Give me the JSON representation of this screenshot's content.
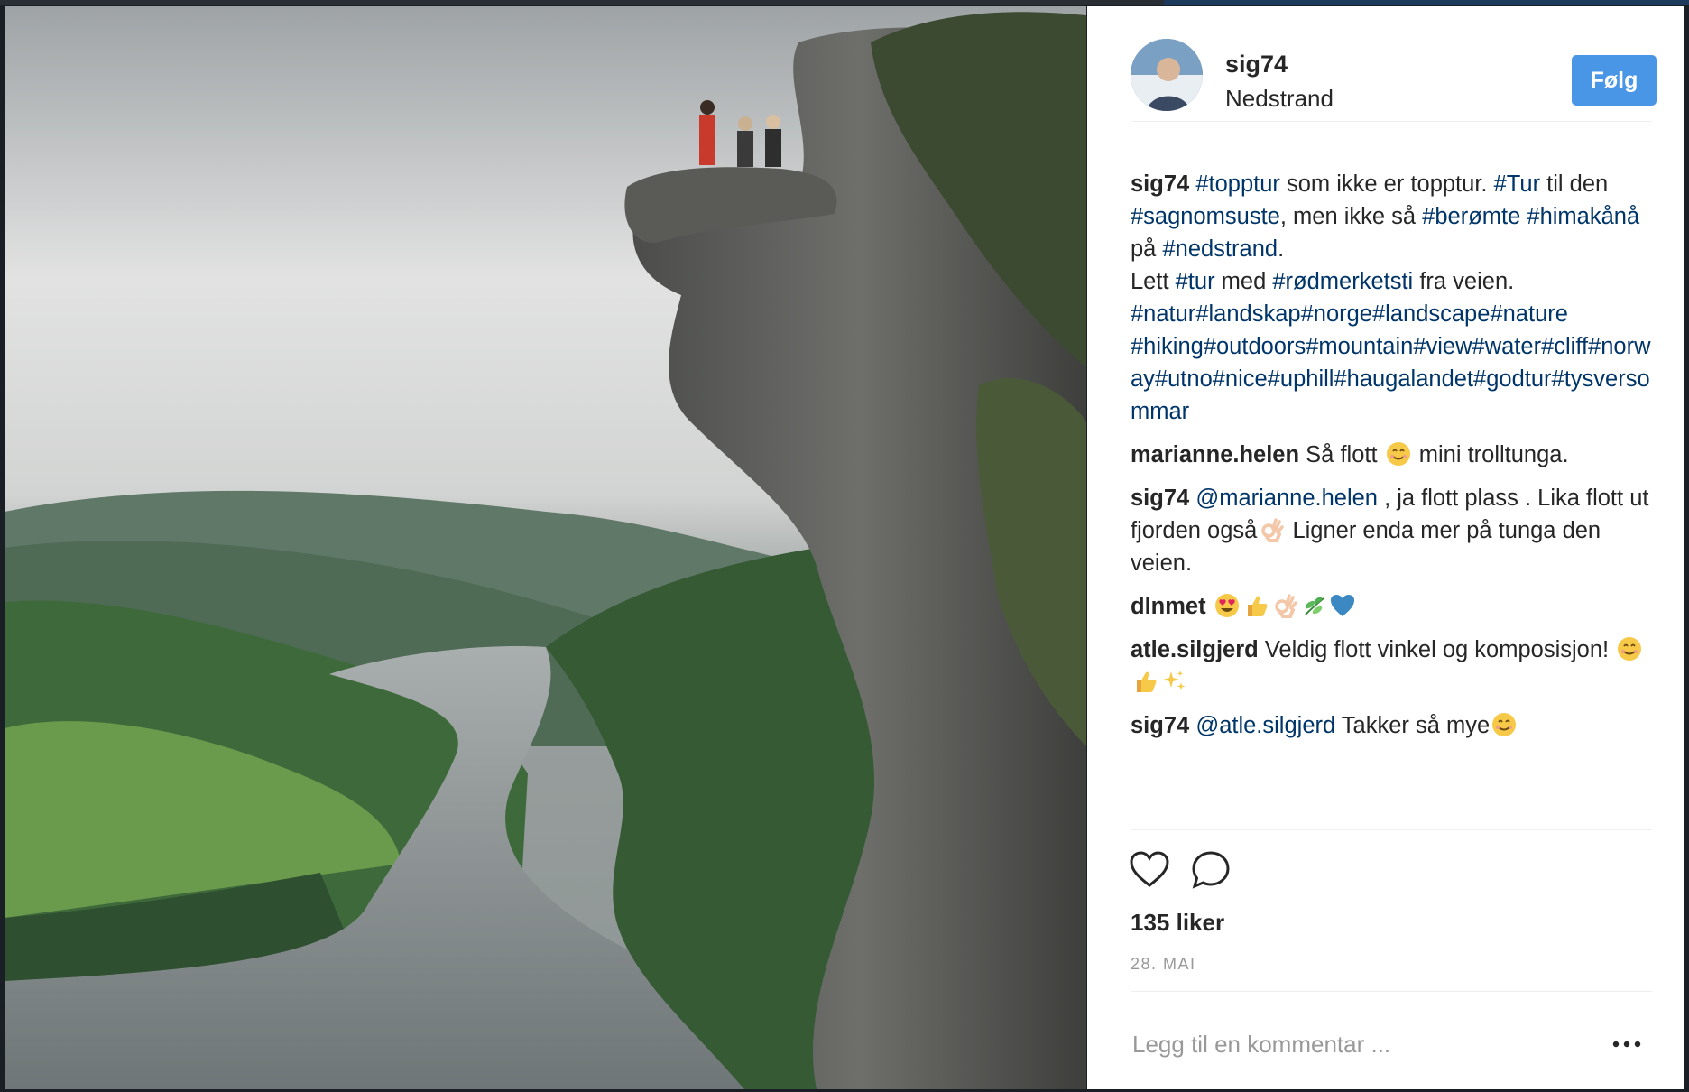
{
  "photo": {
    "description_icon": "post-photo"
  },
  "header": {
    "username": "sig74",
    "location": "Nedstrand",
    "follow_label": "Følg",
    "avatar_icon": "avatar-photo"
  },
  "caption": {
    "author": "sig74",
    "parts": [
      {
        "t": "tag",
        "v": "#topptur"
      },
      {
        "t": "text",
        "v": " som ikke er topptur. "
      },
      {
        "t": "tag",
        "v": "#Tur"
      },
      {
        "t": "text",
        "v": " til den "
      },
      {
        "t": "tag",
        "v": "#sagnomsuste"
      },
      {
        "t": "text",
        "v": ", men ikke så "
      },
      {
        "t": "tag",
        "v": "#berømte"
      },
      {
        "t": "text",
        "v": " "
      },
      {
        "t": "tag",
        "v": "#himakånå"
      },
      {
        "t": "text",
        "v": " på "
      },
      {
        "t": "tag",
        "v": "#nedstrand"
      },
      {
        "t": "text",
        "v": "."
      },
      {
        "t": "br"
      },
      {
        "t": "text",
        "v": "Lett "
      },
      {
        "t": "tag",
        "v": "#tur"
      },
      {
        "t": "text",
        "v": " med "
      },
      {
        "t": "tag",
        "v": "#rødmerketsti"
      },
      {
        "t": "text",
        "v": " fra veien."
      },
      {
        "t": "br"
      },
      {
        "t": "tag",
        "v": "#natur"
      },
      {
        "t": "tag",
        "v": "#landskap"
      },
      {
        "t": "tag",
        "v": "#norge"
      },
      {
        "t": "tag",
        "v": "#landscape"
      },
      {
        "t": "tag",
        "v": "#nature"
      },
      {
        "t": "br"
      },
      {
        "t": "tag",
        "v": "#hiking"
      },
      {
        "t": "tag",
        "v": "#outdoors"
      },
      {
        "t": "tag",
        "v": "#mountain"
      },
      {
        "t": "tag",
        "v": "#view"
      },
      {
        "t": "tag",
        "v": "#water"
      },
      {
        "t": "tag",
        "v": "#cliff"
      },
      {
        "t": "tag",
        "v": "#norway"
      },
      {
        "t": "tag",
        "v": "#utno"
      },
      {
        "t": "tag",
        "v": "#nice"
      },
      {
        "t": "tag",
        "v": "#uphill"
      },
      {
        "t": "tag",
        "v": "#haugalandet"
      },
      {
        "t": "tag",
        "v": "#godtur"
      },
      {
        "t": "tag",
        "v": "#tysversommar"
      }
    ]
  },
  "comments": [
    {
      "author": "marianne.helen",
      "parts": [
        {
          "t": "text",
          "v": "Så flott "
        },
        {
          "t": "emoji",
          "v": "smiling-face-emoji"
        },
        {
          "t": "text",
          "v": " mini trolltunga."
        }
      ]
    },
    {
      "author": "sig74",
      "parts": [
        {
          "t": "mention",
          "v": "@marianne.helen"
        },
        {
          "t": "text",
          "v": " , ja flott plass . Lika flott ut fjorden også"
        },
        {
          "t": "emoji",
          "v": "ok-hand-emoji"
        },
        {
          "t": "text",
          "v": " Ligner enda mer på tunga den veien."
        }
      ]
    },
    {
      "author": "dlnmet",
      "parts": [
        {
          "t": "emoji",
          "v": "heart-eyes-emoji"
        },
        {
          "t": "emoji",
          "v": "thumbs-up-emoji"
        },
        {
          "t": "emoji",
          "v": "ok-hand-emoji"
        },
        {
          "t": "emoji",
          "v": "herb-emoji"
        },
        {
          "t": "emoji",
          "v": "blue-heart-emoji"
        }
      ]
    },
    {
      "author": "atle.silgjerd",
      "parts": [
        {
          "t": "text",
          "v": "Veldig flott vinkel og komposisjon! "
        },
        {
          "t": "emoji",
          "v": "smiling-face-emoji"
        },
        {
          "t": "emoji",
          "v": "thumbs-up-emoji"
        },
        {
          "t": "emoji",
          "v": "sparkles-emoji"
        }
      ]
    },
    {
      "author": "sig74",
      "parts": [
        {
          "t": "mention",
          "v": "@atle.silgjerd"
        },
        {
          "t": "text",
          "v": " Takker så mye"
        },
        {
          "t": "emoji",
          "v": "smiling-face-emoji"
        }
      ]
    }
  ],
  "actions": {
    "like_icon": "heart-icon",
    "comment_icon": "comment-bubble-icon",
    "likes_text": "135 liker",
    "date": "28. MAI"
  },
  "add_comment": {
    "placeholder": "Legg til en kommentar ...",
    "more_icon": "more-options-icon"
  },
  "colors": {
    "accent": "#4a96e6",
    "hashtag": "#003569",
    "text": "#262626",
    "muted": "#999999"
  }
}
